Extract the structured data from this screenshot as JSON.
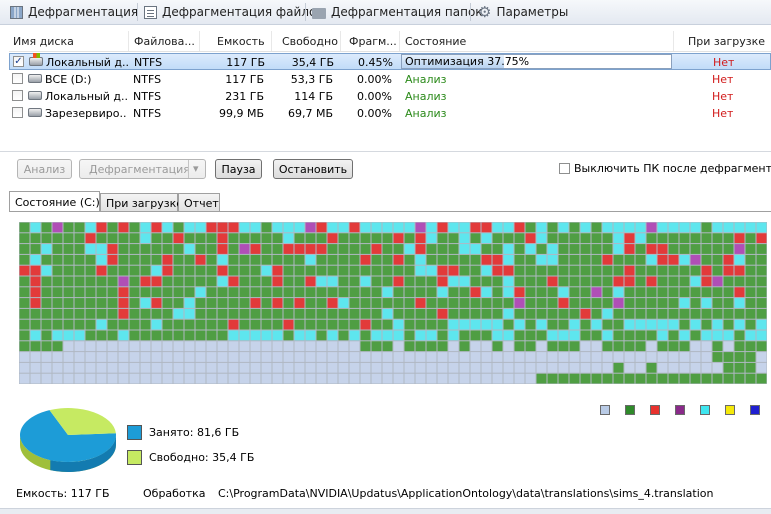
{
  "toolbar": {
    "defrag": "Дефрагментация",
    "defrag_files": "Дефрагментация файлов",
    "defrag_folders": "Дефрагментация папок",
    "settings": "Параметры"
  },
  "columns": [
    "Имя диска",
    "Файлова...",
    "Емкость",
    "Свободно",
    "Фрагм...",
    "Состояние",
    "При загрузке"
  ],
  "disks": [
    {
      "checked": true,
      "name": "Локальный д...",
      "fs": "NTFS",
      "capacity": "117 ГБ",
      "free": "35,4 ГБ",
      "frag": "0.45%",
      "status": "Оптимизация 37.75%",
      "boot": "Нет",
      "progress": 37.75
    },
    {
      "checked": false,
      "name": "ВСЕ (D:)",
      "fs": "NTFS",
      "capacity": "117 ГБ",
      "free": "53,3 ГБ",
      "frag": "0.00%",
      "status": "Анализ",
      "boot": "Нет"
    },
    {
      "checked": false,
      "name": "Локальный д...",
      "fs": "NTFS",
      "capacity": "231 ГБ",
      "free": "114 ГБ",
      "frag": "0.00%",
      "status": "Анализ",
      "boot": "Нет"
    },
    {
      "checked": false,
      "name": "Зарезервиро...",
      "fs": "NTFS",
      "capacity": "99,9 МБ",
      "free": "69,7 МБ",
      "frag": "0.00%",
      "status": "Анализ",
      "boot": "Нет"
    }
  ],
  "buttons": {
    "analyze": "Анализ",
    "defrag": "Дефрагментация",
    "dropdown_glyph": "▾",
    "pause": "Пауза",
    "stop": "Остановить"
  },
  "shutdown_label": "Выключить ПК после дефрагментации",
  "tabs": [
    "Состояние (C:)",
    "При загрузке",
    "Отчет"
  ],
  "legend_colors": [
    "#b9cbe6",
    "#2f8a2a",
    "#e8322e",
    "#8a2a8a",
    "#3fe6f0",
    "#f5e90a",
    "#1f1fd0"
  ],
  "map_colors": {
    "free": "#c6d3ea",
    "used": "#4f9e43",
    "fragmented": "#e23a3a",
    "system": "#5ee6ee",
    "mft": "#b04fb6"
  },
  "pie": {
    "used_label": "Занято: 81,6 ГБ",
    "free_label": "Свободно: 35,4 ГБ",
    "used_color": "#1d9cd7",
    "free_color": "#c6ea62",
    "used_fraction": 0.697
  },
  "info": {
    "capacity": "Емкость: 117 ГБ",
    "processing_label": "Обработка",
    "path": "C:\\ProgramData\\NVIDIA\\Updatus\\ApplicationOntology\\data\\translations\\sims_4.translation"
  }
}
